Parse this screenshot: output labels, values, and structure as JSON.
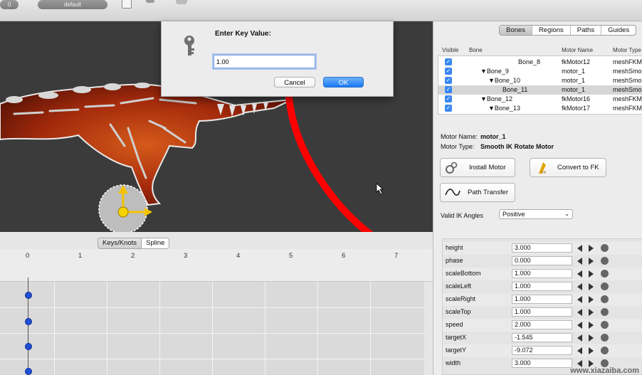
{
  "toolbar": {
    "counter": "0",
    "profile": "default"
  },
  "dialog": {
    "title": "Enter Key Value:",
    "value": "1.00",
    "cancel": "Cancel",
    "ok": "OK"
  },
  "timeline": {
    "tabs": [
      "Keys/Knots",
      "Spline"
    ],
    "ticks": [
      "0",
      "1",
      "2",
      "3",
      "4",
      "5",
      "6",
      "7"
    ]
  },
  "panel": {
    "tabs": [
      "Bones",
      "Regions",
      "Paths",
      "Guides"
    ],
    "columns": {
      "visible": "Visible",
      "bone": "Bone",
      "motor": "Motor Name",
      "type": "Motor Type"
    },
    "rows": [
      {
        "bone": "Bone_8",
        "motor": "fkMotor12",
        "type": "meshFKMo"
      },
      {
        "bone": "▼Bone_9",
        "motor": "motor_1",
        "type": "meshSmo"
      },
      {
        "bone": "▼Bone_10",
        "motor": "motor_1",
        "type": "meshSmo"
      },
      {
        "bone": "Bone_11",
        "motor": "motor_1",
        "type": "meshSmo"
      },
      {
        "bone": "▼Bone_12",
        "motor": "fkMotor16",
        "type": "meshFKMo"
      },
      {
        "bone": "▼Bone_13",
        "motor": "fkMotor17",
        "type": "meshFKMo"
      }
    ],
    "motor_name_label": "Motor Name:",
    "motor_name": "motor_1",
    "motor_type_label": "Motor Type:",
    "motor_type": "Smooth IK Rotate Motor",
    "install_motor": "Install Motor",
    "convert_fk": "Convert to FK",
    "path_transfer": "Path Transfer",
    "valid_ik_label": "Valid IK Angles",
    "valid_ik_value": "Positive",
    "properties": [
      {
        "name": "height",
        "value": "3.000"
      },
      {
        "name": "phase",
        "value": "0.000"
      },
      {
        "name": "scaleBottom",
        "value": "1.000"
      },
      {
        "name": "scaleLeft",
        "value": "1.000"
      },
      {
        "name": "scaleRight",
        "value": "1.000"
      },
      {
        "name": "scaleTop",
        "value": "1.000"
      },
      {
        "name": "speed",
        "value": "2.000"
      },
      {
        "name": "targetX",
        "value": "-1.545"
      },
      {
        "name": "targetY",
        "value": "-9.072"
      },
      {
        "name": "width",
        "value": "3.000"
      }
    ]
  },
  "watermark": "www.xiazaiba.com"
}
